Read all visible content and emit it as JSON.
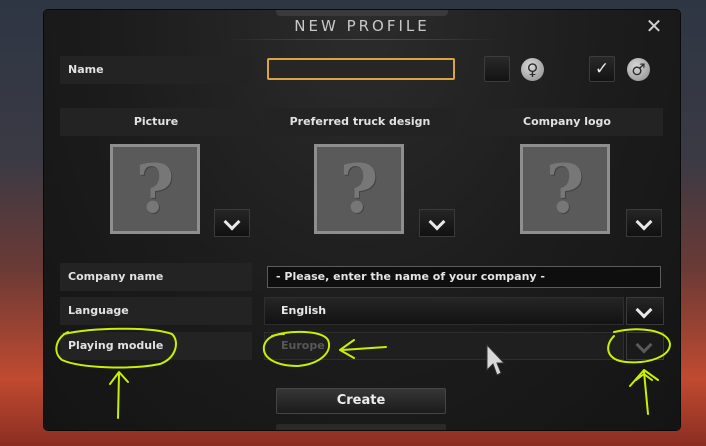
{
  "dialog": {
    "title": "NEW PROFILE",
    "close_icon": "close-icon"
  },
  "name_row": {
    "label": "Name",
    "value": "",
    "female_checked": false,
    "male_checked": true,
    "female_symbol": "♀",
    "male_symbol": "♂",
    "check_symbol": "✓"
  },
  "columns": [
    {
      "label": "Picture",
      "placeholder": "?"
    },
    {
      "label": "Preferred truck design",
      "placeholder": "?"
    },
    {
      "label": "Company logo",
      "placeholder": "?"
    }
  ],
  "company_name": {
    "label": "Company name",
    "value": "- Please, enter the name of your company -"
  },
  "language": {
    "label": "Language",
    "value": "English"
  },
  "playing_module": {
    "label": "Playing module",
    "value": "Europe",
    "enabled": false
  },
  "create_button": "Create",
  "colors": {
    "accent_border": "#d9a441",
    "annotation": "#c8f000"
  }
}
